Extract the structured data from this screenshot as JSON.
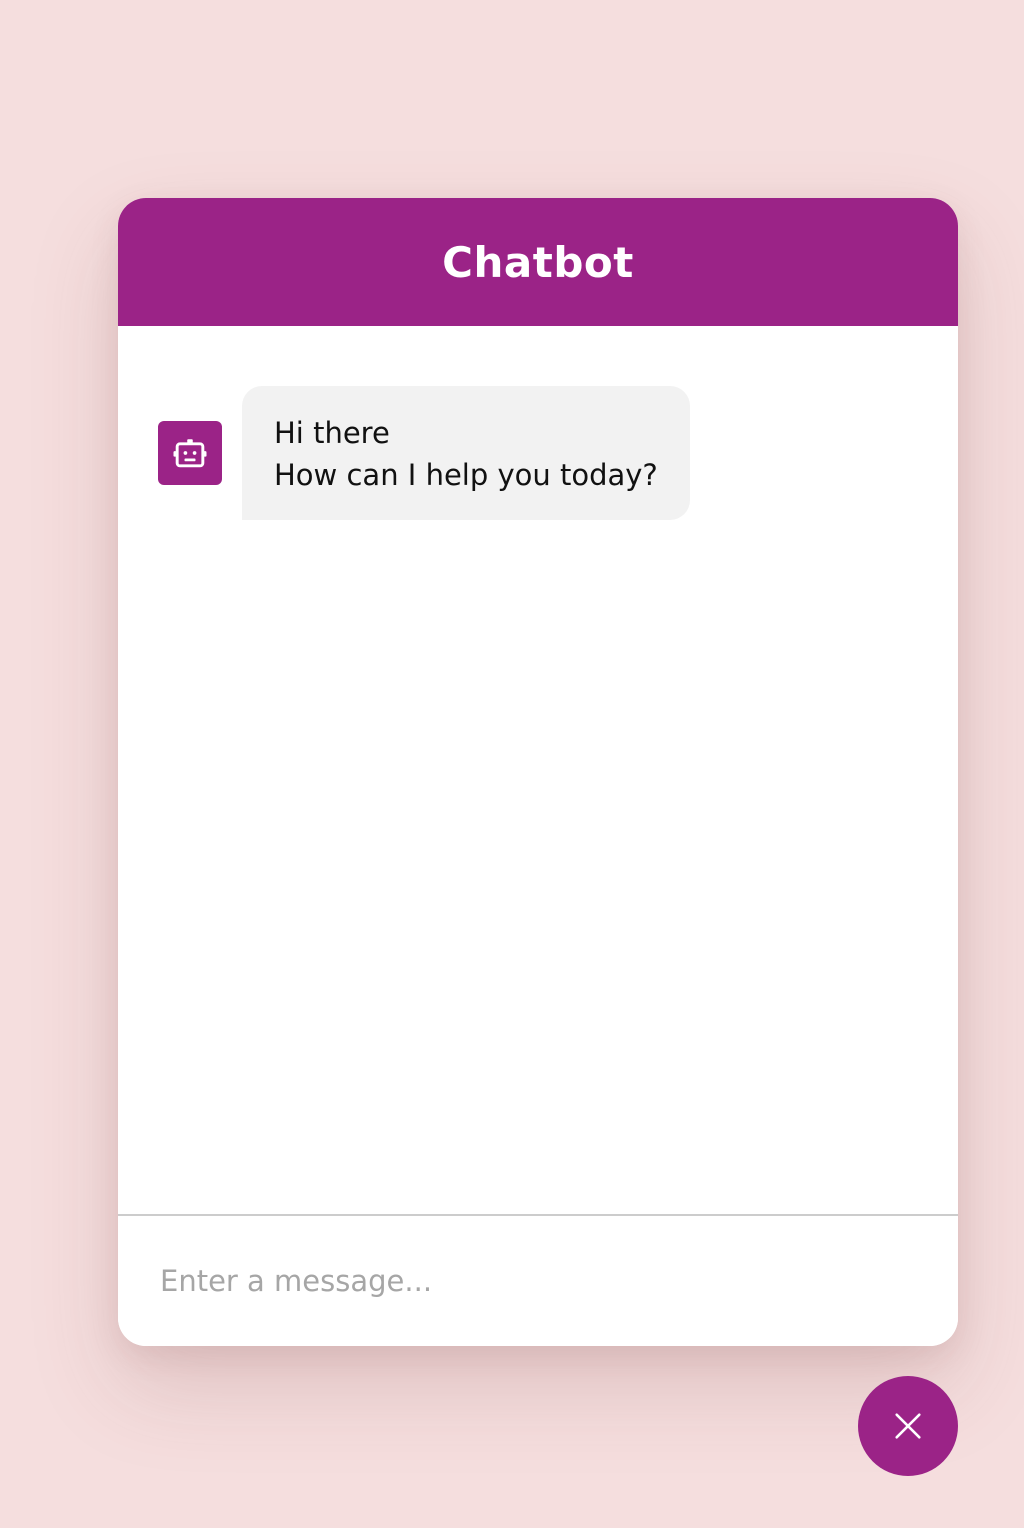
{
  "header": {
    "title": "Chatbot"
  },
  "messages": [
    {
      "sender": "bot",
      "avatar_icon": "robot-icon",
      "text": "Hi there\n How can I help you today?"
    }
  ],
  "input": {
    "placeholder": "Enter a message...",
    "value": ""
  },
  "toggle": {
    "icon": "close-icon"
  },
  "colors": {
    "accent": "#9b2387",
    "page_background": "#f5dede",
    "bubble_background": "#f2f2f2"
  }
}
